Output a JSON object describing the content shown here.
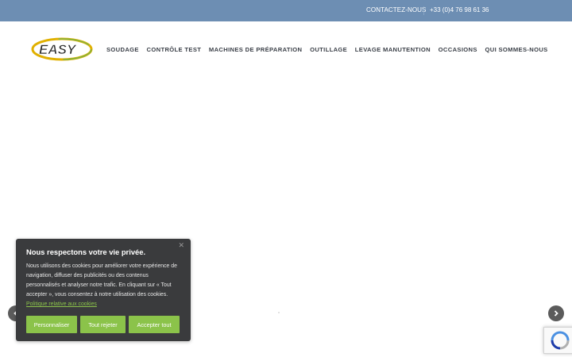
{
  "topbar": {
    "contact_label": "CONTACTEZ-NOUS",
    "phone": "+33 (0)4 76 98 61 36",
    "background": "#6d8eb3"
  },
  "header": {
    "logo_text": "EASY",
    "nav": [
      {
        "label": "SOUDAGE"
      },
      {
        "label": "CONTRÔLE TEST"
      },
      {
        "label": "MACHINES DE PRÉPARATION"
      },
      {
        "label": "OUTILLAGE"
      },
      {
        "label": "LEVAGE MANUTENTION"
      },
      {
        "label": "OCCASIONS"
      },
      {
        "label": "QUI SOMMES-NOUS"
      }
    ]
  },
  "slider": {
    "prev_icon": "chevron-left-icon",
    "next_icon": "chevron-right-icon"
  },
  "cookie_banner": {
    "title": "Nous respectons votre vie privée.",
    "text": "Nous utilisons des cookies pour améliorer votre expérience de navigation, diffuser des publicités ou des contenus personnalisés et analyser notre trafic. En cliquant sur « Tout accepter », vous consentez à notre utilisation des cookies.",
    "policy_link": "Politique relative aux cookies",
    "close_icon": "close-icon",
    "buttons": {
      "personalize": "Personnaliser",
      "reject": "Tout rejeter",
      "accept": "Accepter tout"
    },
    "accent": "#8bc34a"
  },
  "recaptcha": {
    "icon": "recaptcha-icon"
  }
}
